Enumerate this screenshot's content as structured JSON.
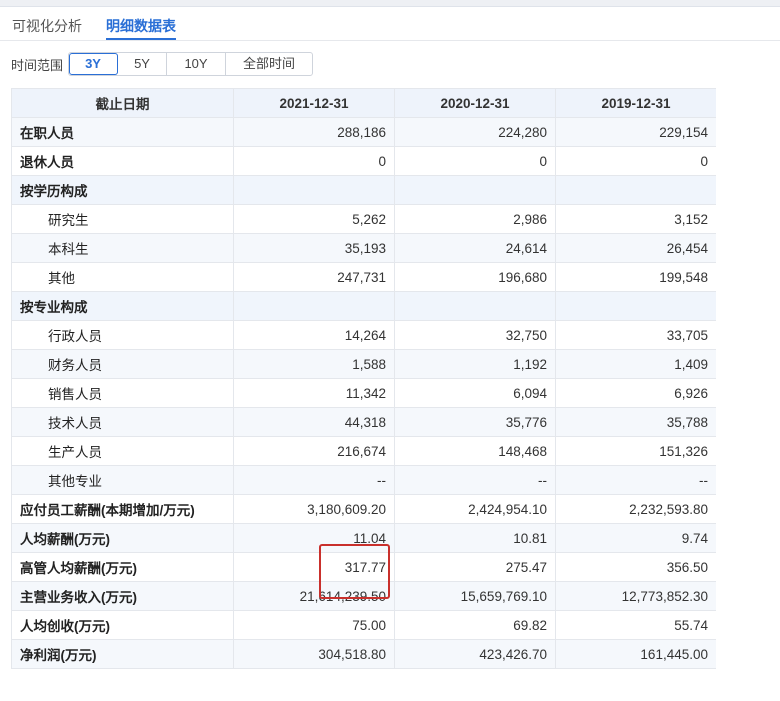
{
  "tabs": [
    {
      "label": "可视化分析"
    },
    {
      "label": "明细数据表"
    }
  ],
  "range": {
    "label": "时间范围",
    "options": [
      "3Y",
      "5Y",
      "10Y",
      "全部时间"
    ],
    "selected": "3Y"
  },
  "table": {
    "headers": [
      "截止日期",
      "2021-12-31",
      "2020-12-31",
      "2019-12-31"
    ],
    "rows": [
      {
        "label": "在职人员",
        "values": [
          "288,186",
          "224,280",
          "229,154"
        ]
      },
      {
        "label": "退休人员",
        "values": [
          "0",
          "0",
          "0"
        ]
      },
      {
        "label": "按学历构成",
        "values": [
          "",
          "",
          ""
        ]
      },
      {
        "label": "研究生",
        "values": [
          "5,262",
          "2,986",
          "3,152"
        ]
      },
      {
        "label": "本科生",
        "values": [
          "35,193",
          "24,614",
          "26,454"
        ]
      },
      {
        "label": "其他",
        "values": [
          "247,731",
          "196,680",
          "199,548"
        ]
      },
      {
        "label": "按专业构成",
        "values": [
          "",
          "",
          ""
        ]
      },
      {
        "label": "行政人员",
        "values": [
          "14,264",
          "32,750",
          "33,705"
        ]
      },
      {
        "label": "财务人员",
        "values": [
          "1,588",
          "1,192",
          "1,409"
        ]
      },
      {
        "label": "销售人员",
        "values": [
          "11,342",
          "6,094",
          "6,926"
        ]
      },
      {
        "label": "技术人员",
        "values": [
          "44,318",
          "35,776",
          "35,788"
        ]
      },
      {
        "label": "生产人员",
        "values": [
          "216,674",
          "148,468",
          "151,326"
        ]
      },
      {
        "label": "其他专业",
        "values": [
          "--",
          "--",
          "--"
        ]
      },
      {
        "label": "应付员工薪酬(本期增加/万元)",
        "values": [
          "3,180,609.20",
          "2,424,954.10",
          "2,232,593.80"
        ]
      },
      {
        "label": "人均薪酬(万元)",
        "values": [
          "11.04",
          "10.81",
          "9.74"
        ]
      },
      {
        "label": "高管人均薪酬(万元)",
        "values": [
          "317.77",
          "275.47",
          "356.50"
        ]
      },
      {
        "label": "主营业务收入(万元)",
        "values": [
          "21,614,239.50",
          "15,659,769.10",
          "12,773,852.30"
        ]
      },
      {
        "label": "人均创收(万元)",
        "values": [
          "75.00",
          "69.82",
          "55.74"
        ]
      },
      {
        "label": "净利润(万元)",
        "values": [
          "304,518.80",
          "423,426.70",
          "161,445.00"
        ]
      }
    ]
  },
  "colors": {
    "accent": "#2a6fd6",
    "highlight": "#c9302c",
    "header_bg": "#eef3fb"
  }
}
